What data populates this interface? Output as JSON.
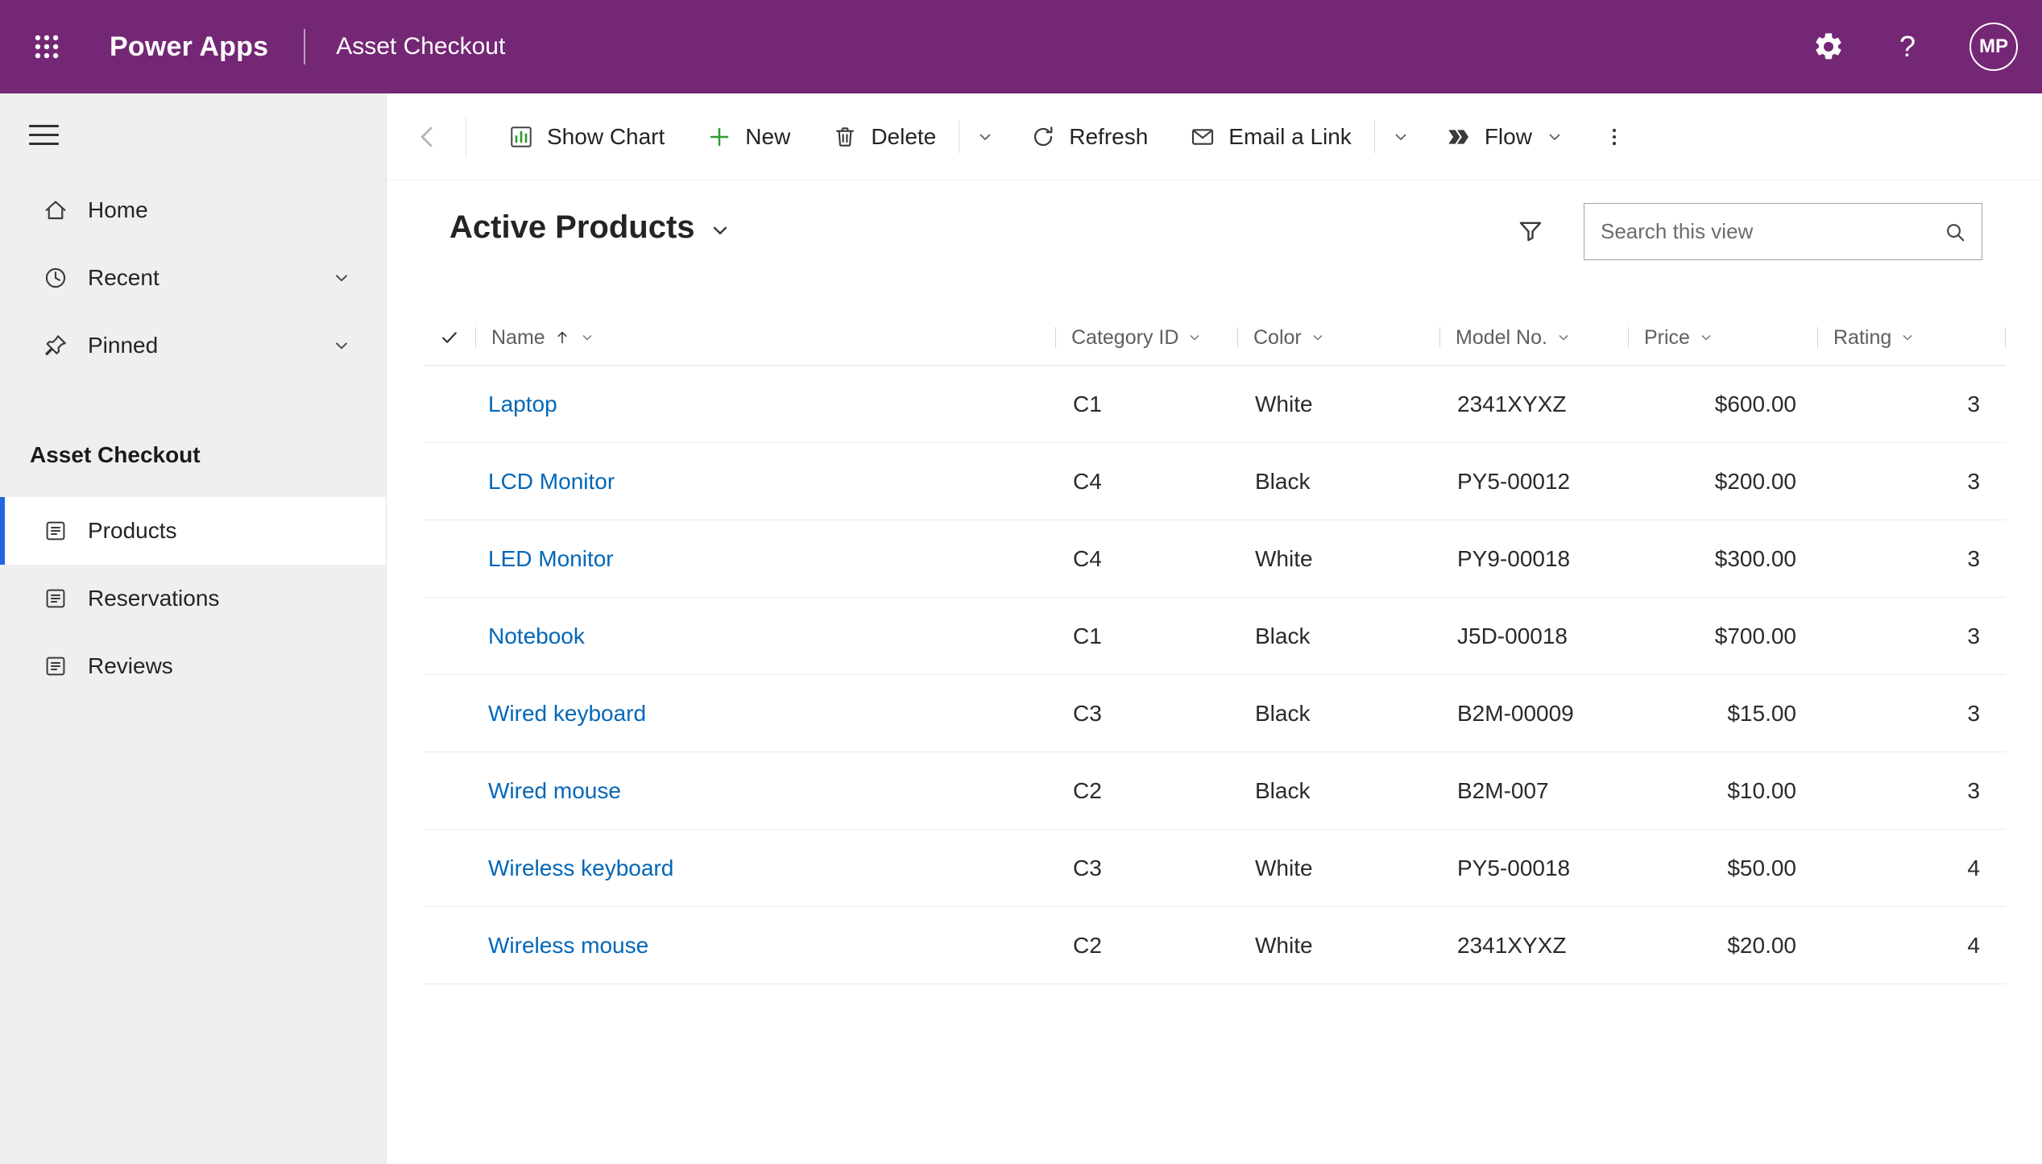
{
  "topbar": {
    "app": "Power Apps",
    "title": "Asset Checkout",
    "avatar_initials": "MP"
  },
  "sidebar": {
    "nav": [
      {
        "label": "Home"
      },
      {
        "label": "Recent"
      },
      {
        "label": "Pinned"
      }
    ],
    "section": "Asset Checkout",
    "entities": [
      {
        "label": "Products",
        "selected": true
      },
      {
        "label": "Reservations",
        "selected": false
      },
      {
        "label": "Reviews",
        "selected": false
      }
    ]
  },
  "commandbar": {
    "show_chart": "Show Chart",
    "new": "New",
    "delete": "Delete",
    "refresh": "Refresh",
    "email_link": "Email a Link",
    "flow": "Flow"
  },
  "view": {
    "title": "Active Products",
    "search_placeholder": "Search this view"
  },
  "table": {
    "columns": [
      "Name",
      "Category ID",
      "Color",
      "Model No.",
      "Price",
      "Rating"
    ],
    "sort": {
      "column": "Name",
      "direction": "ascending"
    },
    "rows": [
      [
        "Laptop",
        "C1",
        "White",
        "2341XYXZ",
        "$600.00",
        "3"
      ],
      [
        "LCD Monitor",
        "C4",
        "Black",
        "PY5-00012",
        "$200.00",
        "3"
      ],
      [
        "LED Monitor",
        "C4",
        "White",
        "PY9-00018",
        "$300.00",
        "3"
      ],
      [
        "Notebook",
        "C1",
        "Black",
        "J5D-00018",
        "$700.00",
        "3"
      ],
      [
        "Wired keyboard",
        "C3",
        "Black",
        "B2M-00009",
        "$15.00",
        "3"
      ],
      [
        "Wired mouse",
        "C2",
        "Black",
        "B2M-007",
        "$10.00",
        "3"
      ],
      [
        "Wireless keyboard",
        "C3",
        "White",
        "PY5-00018",
        "$50.00",
        "4"
      ],
      [
        "Wireless mouse",
        "C2",
        "White",
        "2341XYXZ",
        "$20.00",
        "4"
      ]
    ]
  },
  "colors": {
    "brand_purple": "#742774",
    "link_blue": "#0067b8",
    "selected_accent_blue": "#2266e3",
    "new_plus_green": "#2f9b2f",
    "sidebar_gray": "#efefef"
  },
  "icons": [
    "waffle-icon",
    "settings-gear-icon",
    "help-icon",
    "avatar",
    "hamburger-icon",
    "home-icon",
    "clock-icon",
    "pin-icon",
    "entity-icon",
    "back-chevron-icon",
    "show-chart-icon",
    "plus-icon",
    "trash-icon",
    "refresh-icon",
    "email-link-icon",
    "flow-icon",
    "more-vertical-icon",
    "chevron-down-icon",
    "filter-icon",
    "search-icon",
    "select-all-check-icon",
    "sort-ascending-icon"
  ]
}
